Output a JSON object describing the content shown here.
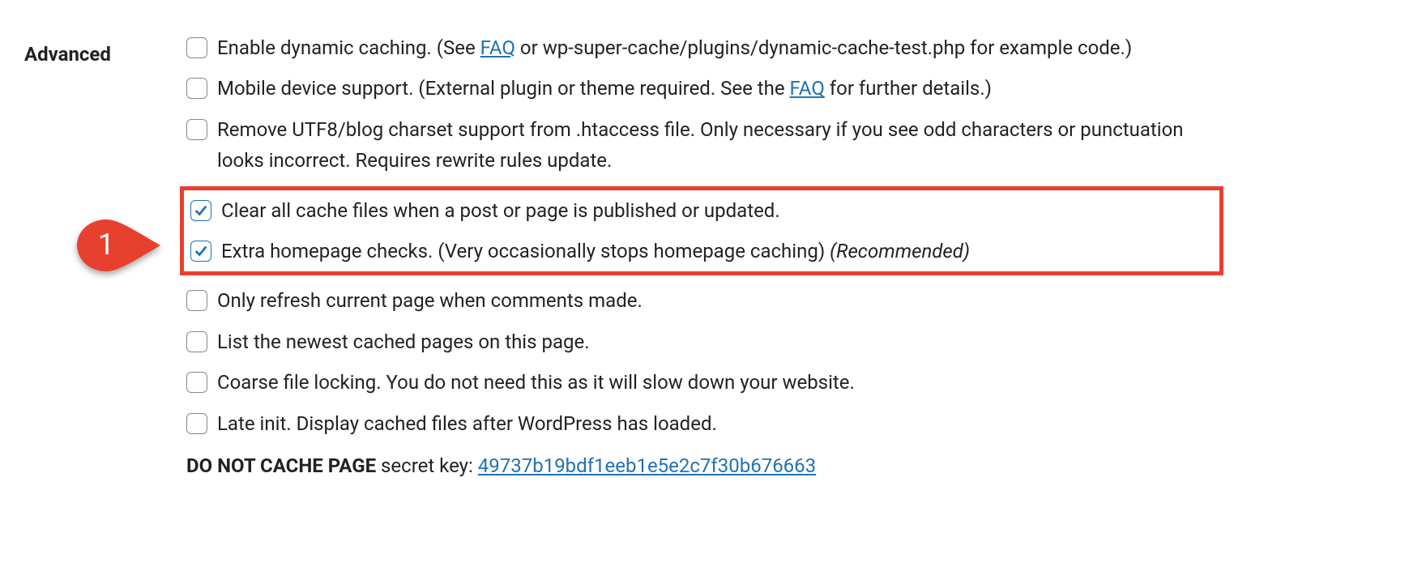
{
  "section_label": "Advanced",
  "callout_number": "1",
  "options": [
    {
      "checked": false,
      "text_pre": "Enable dynamic caching. (See ",
      "link": "FAQ",
      "text_post": " or wp-super-cache/plugins/dynamic-cache-test.php for example code.)"
    },
    {
      "checked": false,
      "text_pre": "Mobile device support. (External plugin or theme required. See the ",
      "link": "FAQ",
      "text_post": " for further details.)"
    },
    {
      "checked": false,
      "text_pre": "Remove UTF8/blog charset support from .htaccess file. Only necessary if you see odd characters or punctuation looks incorrect. Requires rewrite rules update.",
      "link": "",
      "text_post": ""
    },
    {
      "checked": true,
      "text_pre": "Clear all cache files when a post or page is published or updated.",
      "link": "",
      "text_post": ""
    },
    {
      "checked": true,
      "text_pre": "Extra homepage checks. (Very occasionally stops homepage caching) ",
      "link": "",
      "text_post": "",
      "italic": "(Recommended)"
    },
    {
      "checked": false,
      "text_pre": "Only refresh current page when comments made.",
      "link": "",
      "text_post": ""
    },
    {
      "checked": false,
      "text_pre": "List the newest cached pages on this page.",
      "link": "",
      "text_post": ""
    },
    {
      "checked": false,
      "text_pre": "Coarse file locking. You do not need this as it will slow down your website.",
      "link": "",
      "text_post": ""
    },
    {
      "checked": false,
      "text_pre": "Late init. Display cached files after WordPress has loaded.",
      "link": "",
      "text_post": ""
    }
  ],
  "secret_key_label_bold": "DO NOT CACHE PAGE",
  "secret_key_label_rest": " secret key: ",
  "secret_key_value": "49737b19bdf1eeb1e5e2c7f30b676663"
}
